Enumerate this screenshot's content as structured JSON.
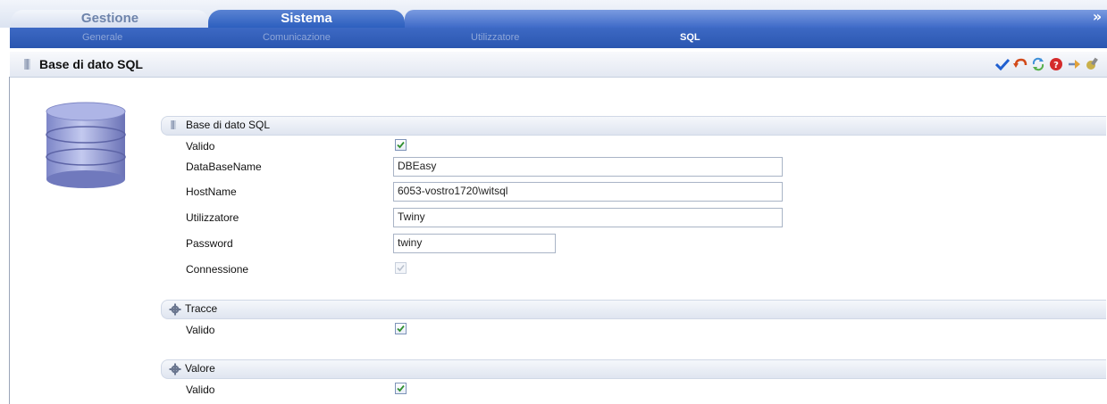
{
  "tabs": [
    {
      "label": "Gestione",
      "active": false
    },
    {
      "label": "Sistema",
      "active": true
    }
  ],
  "collapse_glyph": "»",
  "submenu": [
    {
      "label": "Generale",
      "selected": false
    },
    {
      "label": "Comunicazione",
      "selected": false
    },
    {
      "label": "Utilizzatore",
      "selected": false
    },
    {
      "label": "SQL",
      "selected": true
    }
  ],
  "header": {
    "title": "Base di dato SQL",
    "tools": [
      "check-icon",
      "undo-icon",
      "refresh-icon",
      "help-icon",
      "next-icon",
      "tools-icon"
    ]
  },
  "sections": {
    "db": {
      "title": "Base di dato SQL",
      "valido_label": "Valido",
      "valido_checked": true,
      "dbname_label": "DataBaseName",
      "dbname_value": "DBEasy",
      "host_label": "HostName",
      "host_value": "6053-vostro1720\\witsql",
      "user_label": "Utilizzatore",
      "user_value": "Twiny",
      "password_label": "Password",
      "password_value": "twiny",
      "connessione_label": "Connessione",
      "connessione_checked": true
    },
    "tracce": {
      "title": "Tracce",
      "valido_label": "Valido",
      "valido_checked": true
    },
    "valore": {
      "title": "Valore",
      "valido_label": "Valido",
      "valido_checked": true
    }
  },
  "colors": {
    "accent": "#2c5fbf",
    "check": "#2f8f2f"
  }
}
